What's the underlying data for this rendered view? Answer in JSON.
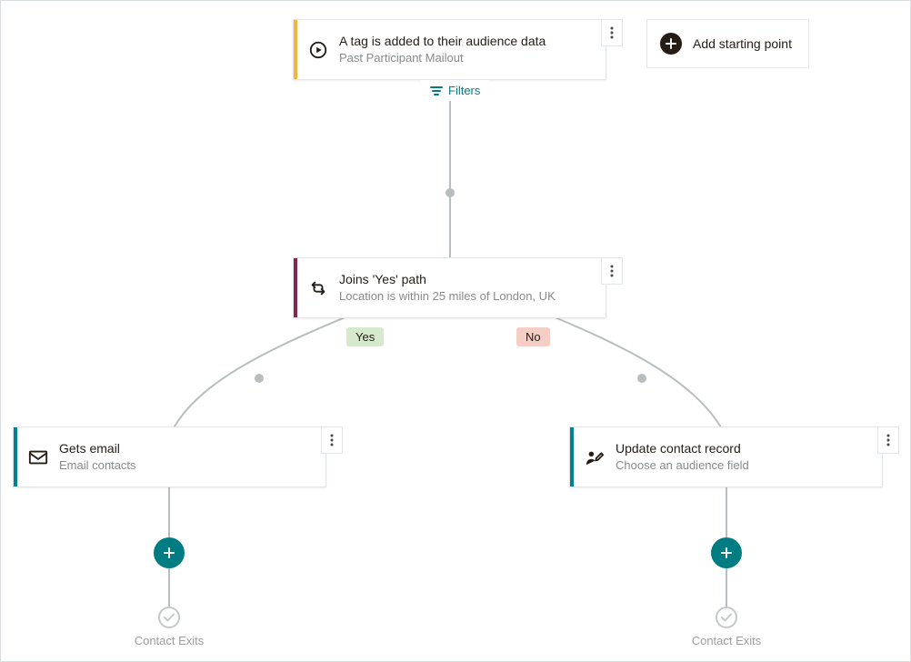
{
  "starting_point": {
    "title": "A tag is added to their audience data",
    "subtitle": "Past Participant Mailout",
    "icon": "play-circle"
  },
  "add_starting_point": {
    "label": "Add starting point"
  },
  "filters": {
    "label": "Filters"
  },
  "condition": {
    "title": "Joins 'Yes' path",
    "subtitle": "Location is within 25 miles of London, UK",
    "icon": "branch-arrows"
  },
  "branches": {
    "yes": "Yes",
    "no": "No"
  },
  "left_action": {
    "title": "Gets email",
    "subtitle": "Email contacts",
    "icon": "envelope"
  },
  "right_action": {
    "title": "Update contact record",
    "subtitle": "Choose an audience field",
    "icon": "edit-user"
  },
  "exit": {
    "label": "Contact Exits"
  }
}
